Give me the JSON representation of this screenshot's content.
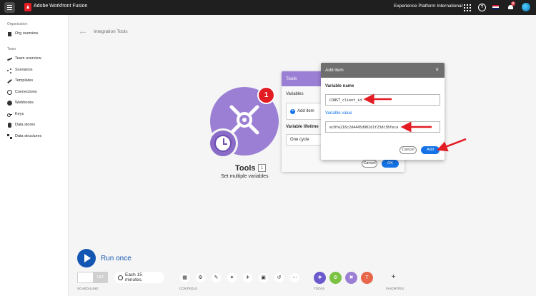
{
  "topbar": {
    "app_title": "Adobe Workfront Fusion",
    "org_name": "Experience Platform International",
    "notification_count": "8"
  },
  "sidebar": {
    "org_section": "Organization",
    "org_overview": "Org overview",
    "team_section": "Team",
    "items": [
      {
        "label": "Team overview"
      },
      {
        "label": "Scenarios"
      },
      {
        "label": "Templates"
      },
      {
        "label": "Connections"
      },
      {
        "label": "Webhooks"
      },
      {
        "label": "Keys"
      },
      {
        "label": "Data stores"
      },
      {
        "label": "Data structures"
      }
    ]
  },
  "main": {
    "breadcrumb": "Integration Tools",
    "module": {
      "name": "Tools",
      "count": "1",
      "subtitle": "Set multiple variables",
      "badge": "1"
    }
  },
  "tools_panel": {
    "title": "Tools",
    "variables_label": "Variables",
    "add_item": "Add item",
    "lifetime_label": "Variable lifetime",
    "lifetime_value": "One cycle",
    "cancel": "Cancel",
    "ok": "OK"
  },
  "modal": {
    "title": "Add item",
    "name_label": "Variable name",
    "name_value": "CONST_client_id",
    "value_label": "Variable value",
    "value_value": "ec0fe216c2d4445d902d1f23dc36fece",
    "cancel": "Cancel",
    "add": "Add"
  },
  "bottom": {
    "run_once": "Run once",
    "toggle_state": "OFF",
    "schedule": "Each 15 minutes.",
    "scheduling_label": "SCHEDULING",
    "controls_label": "CONTROLS",
    "tools_label": "TOOLS",
    "favorites_label": "FAVORITES"
  },
  "colors": {
    "accent": "#1473e6",
    "module": "#9b7fd4",
    "arrow": "#e31b23"
  }
}
